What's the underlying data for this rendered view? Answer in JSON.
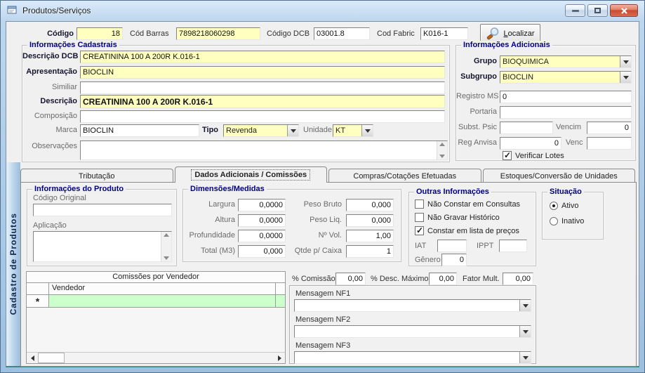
{
  "window": {
    "title": "Produtos/Serviços",
    "sidebar_label": "Cadastro de Produtos"
  },
  "header": {
    "codigo_label": "Código",
    "codigo_value": "18",
    "cod_barras_label": "Cód  Barras",
    "cod_barras_value": "7898218060298",
    "codigo_dcb_label": "Código DCB",
    "codigo_dcb_value": "03001.8",
    "cod_fabric_label": "Cod Fabric",
    "cod_fabric_value": "K016-1",
    "localizar_label": "Localizar"
  },
  "cadastrais": {
    "title": "Informações Cadastrais",
    "descricao_dcb_label": "Descrição DCB",
    "descricao_dcb_value": "CREATININA 100 A 200R K.016-1",
    "apresentacao_label": "Apresentação",
    "apresentacao_value": "BIOCLIN",
    "similiar_label": "Similiar",
    "similiar_value": "",
    "descricao_label": "Descrição",
    "descricao_value": "CREATININA 100 A 200R K.016-1",
    "composicao_label": "Composição",
    "composicao_value": "",
    "marca_label": "Marca",
    "marca_value": "BIOCLIN",
    "tipo_label": "Tipo",
    "tipo_value": "Revenda",
    "unidade_label": "Unidade",
    "unidade_value": "KT",
    "observacoes_label": "Observações",
    "observacoes_value": ""
  },
  "adicionais": {
    "title": "Informações Adicionais",
    "grupo_label": "Grupo",
    "grupo_value": "BIOQUIMICA",
    "subgrupo_label": "Subgrupo",
    "subgrupo_value": "BIOCLIN",
    "registro_ms_label": "Registro MS",
    "registro_ms_value": "0",
    "portaria_label": "Portaria",
    "portaria_value": "",
    "subst_psic_label": "Subst. Psic",
    "subst_psic_value": "",
    "vencim_label": "Vencim",
    "vencim_value": "0",
    "reg_anvisa_label": "Reg Anvisa",
    "reg_anvisa_value": "0",
    "venc_label": "Venc",
    "venc_value": "",
    "verificar_lotes_label": "Verificar Lotes",
    "verificar_lotes_checked": true
  },
  "tabs": [
    {
      "label": "Tributação",
      "active": false
    },
    {
      "label": "Dados Adicionais / Comissões",
      "active": true
    },
    {
      "label": "Compras/Cotações Efetuadas",
      "active": false
    },
    {
      "label": "Estoques/Conversão de Unidades",
      "active": false
    }
  ],
  "produto_info": {
    "title": "Informações do Produto",
    "codigo_original_label": "Código Original",
    "codigo_original_value": "",
    "aplicacao_label": "Aplicação",
    "aplicacao_value": ""
  },
  "dimensoes": {
    "title": "Dimensões/Medidas",
    "left": [
      {
        "label": "Largura",
        "value": "0,0000"
      },
      {
        "label": "Altura",
        "value": "0,0000"
      },
      {
        "label": "Profundidade",
        "value": "0,0000"
      },
      {
        "label": "Total (M3)",
        "value": "0,000"
      }
    ],
    "right": [
      {
        "label": "Peso Bruto",
        "value": "0,000"
      },
      {
        "label": "Peso Liq.",
        "value": "0,000"
      },
      {
        "label": "Nº Vol.",
        "value": "1,00"
      },
      {
        "label": "Qtde p/ Caixa",
        "value": "1"
      }
    ]
  },
  "outras": {
    "title": "Outras Informações",
    "checkboxes": [
      {
        "label": "Não Constar em Consultas",
        "checked": false
      },
      {
        "label": "Não Gravar Histórico",
        "checked": false
      },
      {
        "label": "Constar em lista de preços",
        "checked": true
      }
    ],
    "iat_label": "IAT",
    "iat_value": "",
    "ippt_label": "IPPT",
    "ippt_value": "",
    "genero_label": "Gênero",
    "genero_value": "0"
  },
  "situacao": {
    "title": "Situação",
    "options": [
      {
        "label": "Ativo",
        "selected": true
      },
      {
        "label": "Inativo",
        "selected": false
      }
    ]
  },
  "comissoes": {
    "table_title": "Comissões por Vendedor",
    "vendedor_header": "Vendedor",
    "new_row_marker": "*"
  },
  "percentuais": {
    "comissao_label": "% Comissão",
    "comissao_value": "0,00",
    "desc_maximo_label": "% Desc. Máximo",
    "desc_maximo_value": "0,00",
    "fator_mult_label": "Fator Mult.",
    "fator_mult_value": "0,00"
  },
  "mensagens": [
    {
      "label": "Mensagem NF1",
      "value": ""
    },
    {
      "label": "Mensagem NF2",
      "value": ""
    },
    {
      "label": "Mensagem NF3",
      "value": ""
    }
  ],
  "colors": {
    "field_highlight": "#ffffc0",
    "grid_new_row": "#ccffcc",
    "group_title": "#000080"
  }
}
